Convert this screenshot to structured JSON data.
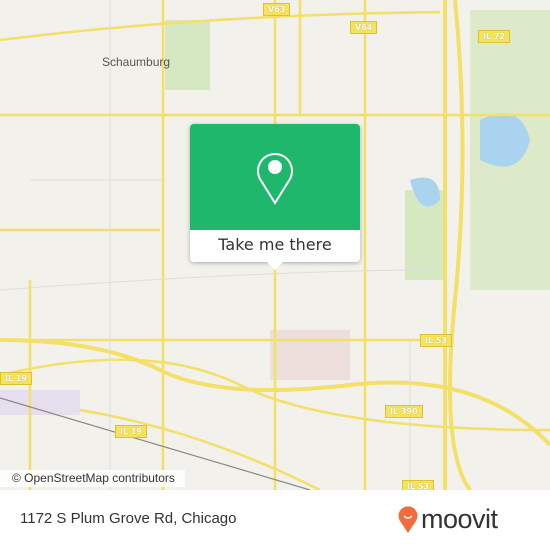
{
  "map": {
    "city_label": "Schaumburg",
    "shields": {
      "v63": "V63",
      "v64": "V64",
      "il72": "IL 72",
      "il53a": "IL 53",
      "il53b": "IL 53",
      "il19a": "IL 19",
      "il19b": "IL 19",
      "il390": "IL 390"
    },
    "attribution": "© OpenStreetMap contributors"
  },
  "popup": {
    "icon": "map-pin-icon",
    "button_label": "Take me there",
    "color": "#1fb76c"
  },
  "footer": {
    "address": "1172 S Plum Grove Rd, Chicago",
    "brand": "moovit",
    "brand_color": "#f26b3a"
  }
}
